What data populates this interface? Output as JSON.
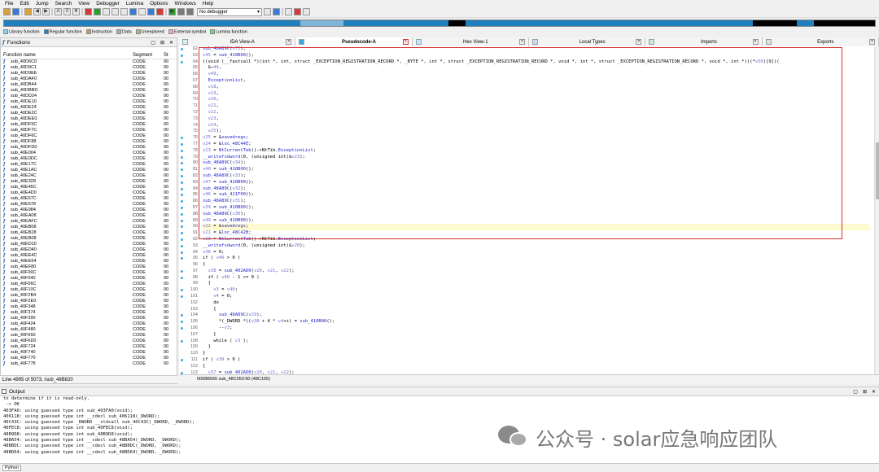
{
  "menu": [
    "File",
    "Edit",
    "Jump",
    "Search",
    "View",
    "Debugger",
    "Lumina",
    "Options",
    "Windows",
    "Help"
  ],
  "toolbar": {
    "debugger_select": "No debugger"
  },
  "navband": {
    "colors": [
      "#1f7fbf",
      "#1f7fbf",
      "#7fb5d9",
      "#1f7fbf",
      "#000000",
      "#1f7fbf",
      "#000000",
      "#1f7fbf",
      "#000000"
    ]
  },
  "legend": [
    {
      "label": "Library function",
      "color": "#7fd4f0"
    },
    {
      "label": "Regular function",
      "color": "#1f7fbf"
    },
    {
      "label": "Instruction",
      "color": "#c89a6a"
    },
    {
      "label": "Data",
      "color": "#a9a9a9"
    },
    {
      "label": "Unexplored",
      "color": "#b5b36a"
    },
    {
      "label": "External symbol",
      "color": "#f0a6c8"
    },
    {
      "label": "Lumina function",
      "color": "#66dd66"
    }
  ],
  "functions_panel": {
    "title": "Functions",
    "col_name": "Function name",
    "col_segment": "Segment",
    "col_start": "St",
    "rows": [
      [
        "sub_40D6C0",
        "CODE",
        "00"
      ],
      [
        "sub_40D9C1",
        "CODE",
        "00"
      ],
      [
        "sub_40D9EE",
        "CODE",
        "00"
      ],
      [
        "sub_40DAF0",
        "CODE",
        "00"
      ],
      [
        "sub_40DB44",
        "CODE",
        "00"
      ],
      [
        "sub_40DBBD",
        "CODE",
        "00"
      ],
      [
        "sub_40DD24",
        "CODE",
        "00"
      ],
      [
        "sub_40DE10",
        "CODE",
        "00"
      ],
      [
        "sub_40DE24",
        "CODE",
        "00"
      ],
      [
        "sub_40DE2C",
        "CODE",
        "00"
      ],
      [
        "sub_40DEE0",
        "CODE",
        "00"
      ],
      [
        "sub_40DF5C",
        "CODE",
        "00"
      ],
      [
        "sub_40DF7C",
        "CODE",
        "00"
      ],
      [
        "sub_40DF6C",
        "CODE",
        "00"
      ],
      [
        "sub_40DF88",
        "CODE",
        "00"
      ],
      [
        "sub_40DFD0",
        "CODE",
        "00"
      ],
      [
        "sub_40E004",
        "CODE",
        "00"
      ],
      [
        "sub_40E0DC",
        "CODE",
        "00"
      ],
      [
        "sub_40E17C",
        "CODE",
        "00"
      ],
      [
        "sub_40E1AC",
        "CODE",
        "00"
      ],
      [
        "sub_40E24C",
        "CODE",
        "00"
      ],
      [
        "sub_40E328",
        "CODE",
        "00"
      ],
      [
        "sub_40E45C",
        "CODE",
        "00"
      ],
      [
        "sub_40E4D0",
        "CODE",
        "00"
      ],
      [
        "sub_40E57C",
        "CODE",
        "00"
      ],
      [
        "sub_40E678",
        "CODE",
        "00"
      ],
      [
        "sub_40E984",
        "CODE",
        "00"
      ],
      [
        "sub_40EA08",
        "CODE",
        "00"
      ],
      [
        "sub_40EAFC",
        "CODE",
        "00"
      ],
      [
        "sub_40EB08",
        "CODE",
        "00"
      ],
      [
        "sub_40EB28",
        "CODE",
        "00"
      ],
      [
        "sub_40EB08",
        "CODE",
        "00"
      ],
      [
        "sub_40ED10",
        "CODE",
        "00"
      ],
      [
        "sub_40ED40",
        "CODE",
        "00"
      ],
      [
        "sub_40EE4C",
        "CODE",
        "00"
      ],
      [
        "sub_40EE64",
        "CODE",
        "00"
      ],
      [
        "sub_40EF80",
        "CODE",
        "00"
      ],
      [
        "sub_40F00C",
        "CODE",
        "00"
      ],
      [
        "sub_40F040",
        "CODE",
        "00"
      ],
      [
        "sub_40F06C",
        "CODE",
        "00"
      ],
      [
        "sub_40F10C",
        "CODE",
        "00"
      ],
      [
        "sub_40F2B4",
        "CODE",
        "00"
      ],
      [
        "sub_40F2E0",
        "CODE",
        "00"
      ],
      [
        "sub_40F348",
        "CODE",
        "00"
      ],
      [
        "sub_40F374",
        "CODE",
        "00"
      ],
      [
        "sub_40F390",
        "CODE",
        "00"
      ],
      [
        "sub_40F424",
        "CODE",
        "00"
      ],
      [
        "sub_40F480",
        "CODE",
        "00"
      ],
      [
        "sub_40F660",
        "CODE",
        "00"
      ],
      [
        "sub_40F6D0",
        "CODE",
        "00"
      ],
      [
        "sub_40F724",
        "CODE",
        "00"
      ],
      [
        "sub_40F740",
        "CODE",
        "00"
      ],
      [
        "sub_40F770",
        "CODE",
        "00"
      ],
      [
        "sub_40F778",
        "CODE",
        "00"
      ]
    ],
    "status": "Line 4995 of 5073, /sub_48B820"
  },
  "tabs": [
    {
      "label": "IDA View-A",
      "active": false,
      "color": "#dfe7f1"
    },
    {
      "label": "Pseudocode-A",
      "active": true,
      "color": "#3aa7e0"
    },
    {
      "label": "Hex View-1",
      "active": false,
      "color": "#cfe0ff"
    },
    {
      "label": "Local Types",
      "active": false,
      "color": "#cfd8e6"
    },
    {
      "label": "Imports",
      "active": false,
      "color": "#d0e6d0"
    },
    {
      "label": "Exports",
      "active": false,
      "color": "#e0e0e0"
    }
  ],
  "code": {
    "lines": [
      {
        "n": "62",
        "dot": true,
        "t": "sub_48A89C(v75);"
      },
      {
        "n": "63",
        "dot": true,
        "t": "v45 = sub_410B00();"
      },
      {
        "n": "64",
        "dot": true,
        "t": "((void (__fastcall *)(int *, int, struct _EXCEPTION_REGISTRATION_RECORD *, _BYTE *, int *, struct _EXCEPTION_REGISTRATION_RECORD *, void *, int *, struct _EXCEPTION_REGISTRATION_RECORD *, void *, int *))(*v50)[9])("
      },
      {
        "n": "65",
        "dot": false,
        "t": "  &v44,"
      },
      {
        "n": "66",
        "dot": false,
        "t": "  v49,"
      },
      {
        "n": "67",
        "dot": false,
        "t": "  ExceptionList,"
      },
      {
        "n": "68",
        "dot": false,
        "t": "  v18,"
      },
      {
        "n": "69",
        "dot": false,
        "t": "  v19,"
      },
      {
        "n": "70",
        "dot": false,
        "t": "  v20,"
      },
      {
        "n": "71",
        "dot": false,
        "t": "  v21,"
      },
      {
        "n": "72",
        "dot": false,
        "t": "  v22,"
      },
      {
        "n": "73",
        "dot": false,
        "t": "  v23,"
      },
      {
        "n": "74",
        "dot": false,
        "t": "  v24,"
      },
      {
        "n": "75",
        "dot": false,
        "t": "  v25);"
      },
      {
        "n": "76",
        "dot": true,
        "t": "v25 = &savedregs;"
      },
      {
        "n": "77",
        "dot": true,
        "t": "v24 = &loc_48C44E;"
      },
      {
        "n": "78",
        "dot": true,
        "t": "v23 = NtCurrentTeb()->NtTib.ExceptionList;"
      },
      {
        "n": "79",
        "dot": true,
        "t": "__writefsdword(0, (unsigned int)&v23);"
      },
      {
        "n": "80",
        "dot": true,
        "t": "sub_48A89C(v34);"
      },
      {
        "n": "81",
        "dot": true,
        "t": "v48 = sub_410B00();"
      },
      {
        "n": "82",
        "dot": true,
        "t": "sub_48A89C(v33);"
      },
      {
        "n": "83",
        "dot": true,
        "t": "v47 = sub_410B00();"
      },
      {
        "n": "84",
        "dot": true,
        "t": "sub_48A89C(v32);"
      },
      {
        "n": "85",
        "dot": true,
        "t": "v46 = sub_411F00();"
      },
      {
        "n": "86",
        "dot": true,
        "t": "sub_48A89C(v31);"
      },
      {
        "n": "87",
        "dot": true,
        "t": "v39 = sub_410B00();"
      },
      {
        "n": "88",
        "dot": true,
        "t": "sub_48A89C(v30);"
      },
      {
        "n": "89",
        "dot": true,
        "t": "v40 = sub_410B00();"
      },
      {
        "n": "90",
        "dot": true,
        "t": "v22 = &savedregs;"
      },
      {
        "n": "91",
        "dot": true,
        "t": "v21 = &loc_48C42B;"
      },
      {
        "n": "92",
        "dot": true,
        "t": "v20 = NtCurrentTeb()->NtTib.ExceptionList;"
      },
      {
        "n": "93",
        "dot": true,
        "t": "__writefsdword(0, (unsigned int)&v20);"
      },
      {
        "n": "94",
        "dot": true,
        "t": "v38 = 0;"
      },
      {
        "n": "95",
        "dot": true,
        "t": "if ( v40 > 0 )"
      },
      {
        "n": "96",
        "dot": false,
        "t": "{"
      },
      {
        "n": "97",
        "dot": true,
        "t": "  v38 = sub_402AD0(v20, v21, v22);"
      },
      {
        "n": "98",
        "dot": true,
        "t": "  if ( v40 - 1 >= 0 )"
      },
      {
        "n": "99",
        "dot": false,
        "t": "  {"
      },
      {
        "n": "100",
        "dot": true,
        "t": "    v3 = v40;"
      },
      {
        "n": "101",
        "dot": true,
        "t": "    v4 = 0;"
      },
      {
        "n": "102",
        "dot": false,
        "t": "    do"
      },
      {
        "n": "103",
        "dot": false,
        "t": "    {"
      },
      {
        "n": "104",
        "dot": true,
        "t": "      sub_48A89C(v29);"
      },
      {
        "n": "105",
        "dot": true,
        "t": "      *(_DWORD *)(v38 + 4 * v4++) = sub_410B00();"
      },
      {
        "n": "106",
        "dot": true,
        "t": "      --v3;"
      },
      {
        "n": "107",
        "dot": false,
        "t": "    }"
      },
      {
        "n": "108",
        "dot": true,
        "t": "    while ( v3 );"
      },
      {
        "n": "109",
        "dot": false,
        "t": "  }"
      },
      {
        "n": "110",
        "dot": false,
        "t": "}"
      },
      {
        "n": "111",
        "dot": true,
        "t": "if ( v39 > 0 )"
      },
      {
        "n": "112",
        "dot": false,
        "t": "{"
      },
      {
        "n": "113",
        "dot": true,
        "t": "  v37 = sub_402AD0(v20, v21, v22);"
      },
      {
        "n": "114",
        "dot": true,
        "t": "  v43 = sub_402AD0(v20, v21, v22);"
      },
      {
        "n": "115",
        "dot": false,
        "t": "  sub_404FDC(v29, dword_40139B);"
      }
    ],
    "highlight_line": "90",
    "status": "0008B565 sub_48C050:90 (48C165)"
  },
  "output": {
    "title": "Output",
    "lines": [
      "to determine if it is read-only.",
      " -> OK",
      "403FA0: using guessed type int sub_403FA0(void);",
      "406118: using guessed type int __cdecl sub_406118(_DWORD);",
      "40C43C: using guessed type _DWORD __stdcall sub_40C43C(_DWORD, _DWORD);",
      "40FEC8: using guessed type int sub_40FEC8(void);",
      "48B9D8: using guessed type int sub_48B9D8(void);",
      "48BA54: using guessed type int __cdecl sub_48BA54(_DWORD, _DWORD);",
      "48BBDC: using guessed type int __cdecl sub_48BBDC(_DWORD, _DWORD);",
      "48BD64: using guessed type int __cdecl sub_48BD64(_DWORD, _DWORD);"
    ],
    "input_mode": "Python"
  },
  "watermark": "公众号 · solar应急响应团队"
}
